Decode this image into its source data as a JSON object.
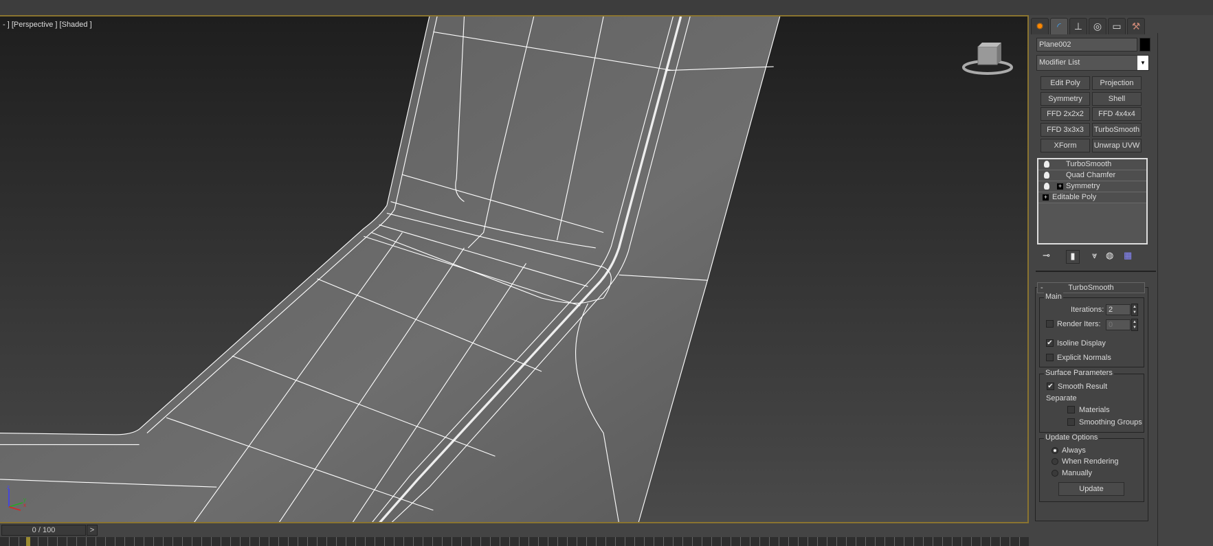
{
  "viewport": {
    "label_plus": "- ]",
    "label_view": "[Perspective ]",
    "label_shading": "[Shaded ]",
    "axes": {
      "x": "x",
      "y": "y",
      "z": "z"
    }
  },
  "timeline": {
    "frame": "0 / 100",
    "next": ">"
  },
  "command_panel": {
    "tabs": [
      {
        "icon": "create-icon",
        "glyph": "✹"
      },
      {
        "icon": "modify-icon",
        "glyph": "◜"
      },
      {
        "icon": "hierarchy-icon",
        "glyph": "⊥"
      },
      {
        "icon": "motion-icon",
        "glyph": "◎"
      },
      {
        "icon": "display-icon",
        "glyph": "▭"
      },
      {
        "icon": "utilities-icon",
        "glyph": "⚒"
      }
    ],
    "active_tab": 1,
    "object_name": "Plane002",
    "object_color": "#000000",
    "modifier_list": "Modifier List",
    "modifier_buttons": [
      "Edit Poly",
      "Projection",
      "Symmetry",
      "Shell",
      "FFD 2x2x2",
      "FFD 4x4x4",
      "FFD 3x3x3",
      "TurboSmooth",
      "XForm",
      "Unwrap UVW"
    ],
    "stack": [
      {
        "label": "TurboSmooth",
        "bulb": true,
        "plus": false
      },
      {
        "label": "Quad Chamfer",
        "bulb": true,
        "plus": false
      },
      {
        "label": "Symmetry",
        "bulb": true,
        "plus": true
      },
      {
        "label": "Editable Poly",
        "bulb": false,
        "plus": true
      }
    ],
    "rollout": {
      "collapse": "-",
      "title": "TurboSmooth",
      "main": {
        "title": "Main",
        "iterations_label": "Iterations:",
        "iterations": "2",
        "render_iters_label": "Render Iters:",
        "render_iters": "0",
        "render_iters_checked": false,
        "isoline_label": "Isoline Display",
        "isoline_checked": true,
        "explicit_label": "Explicit Normals",
        "explicit_checked": false
      },
      "surface": {
        "title": "Surface Parameters",
        "smooth_label": "Smooth Result",
        "smooth_checked": true,
        "separate_label": "Separate",
        "materials_label": "Materials",
        "materials_checked": false,
        "groups_label": "Smoothing Groups",
        "groups_checked": false
      },
      "update": {
        "title": "Update Options",
        "always": "Always",
        "when_rendering": "When Rendering",
        "manually": "Manually",
        "selected": "Always",
        "button": "Update"
      }
    }
  }
}
